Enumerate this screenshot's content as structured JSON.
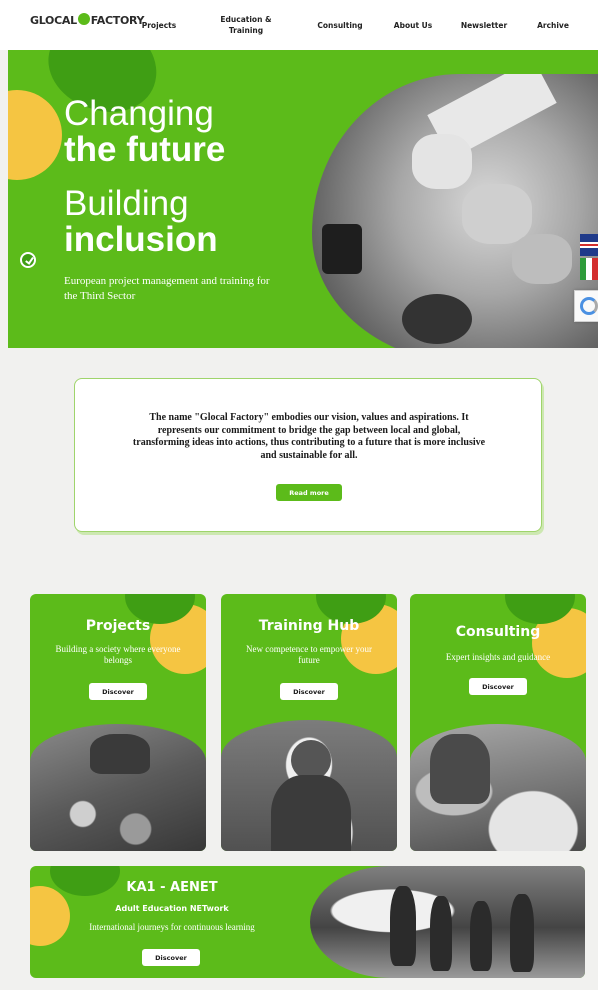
{
  "nav": {
    "logo": {
      "left": "GLOCAL",
      "right": "FACTORY"
    },
    "items": [
      {
        "label": "Projects"
      },
      {
        "label": "Education &",
        "label2": "Training"
      },
      {
        "label": "Consulting"
      },
      {
        "label": "About Us"
      },
      {
        "label": "Newsletter"
      },
      {
        "label": "Archive"
      }
    ]
  },
  "hero": {
    "line1": "Changing",
    "line2": "the future",
    "line3": "Building",
    "line4": "inclusion",
    "subtitle": "European project management and training for the Third Sector"
  },
  "intro": {
    "text": "The name \"Glocal Factory\" embodies our vision, values and aspirations. It represents our commitment to bridge the gap between local and global, transforming ideas into actions, thus contributing to a future that is more inclusive and sustainable for all.",
    "button": "Read more"
  },
  "cards": [
    {
      "title": "Projects",
      "subtitle": "Building a society where everyone belongs",
      "button": "Discover"
    },
    {
      "title": "Training Hub",
      "subtitle": "New competence to empower your future",
      "button": "Discover"
    },
    {
      "title": "Consulting",
      "subtitle": "Expert insights and guidance",
      "button": "Discover"
    }
  ],
  "banner": {
    "title": "KA1 - AENET",
    "subtitle": "Adult Education NETwork",
    "tagline": "International journeys for continuous learning",
    "button": "Discover"
  },
  "icons": {
    "clock": "clock-check-icon",
    "flag_en": "uk-flag-icon",
    "flag_it": "italy-flag-icon",
    "recaptcha": "recaptcha-icon"
  },
  "colors": {
    "brand_green": "#5cbb1a",
    "accent_yellow": "#f5c542",
    "dark_green": "#3f9e14"
  }
}
